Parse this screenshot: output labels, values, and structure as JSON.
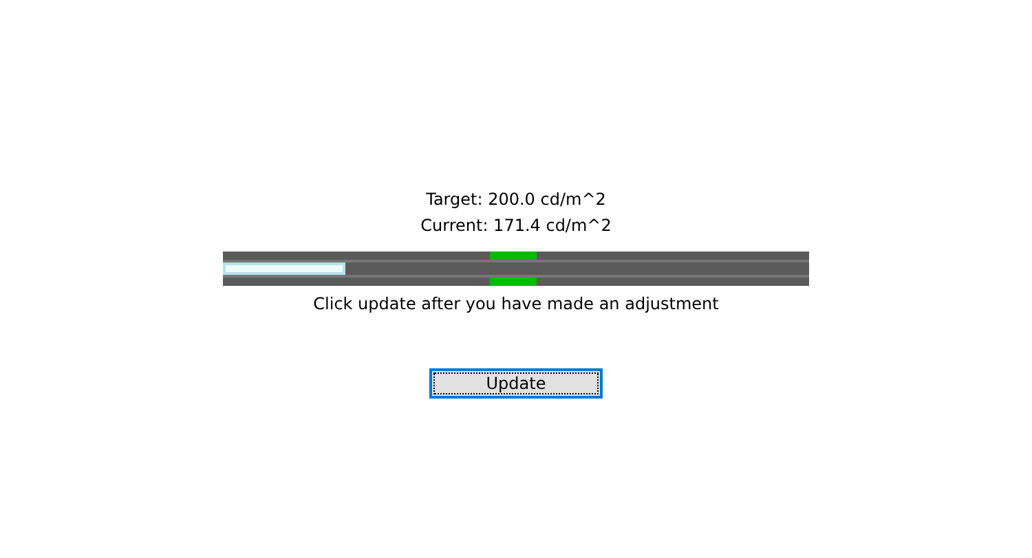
{
  "target": "Target: 200.0 cd/m^2",
  "current": "Current: 171.4 cd/m^2",
  "meter": {
    "level": 0.21
  },
  "hint": "Click update after you have made an adjustment",
  "button": {
    "label": "Update",
    "focused": true
  }
}
